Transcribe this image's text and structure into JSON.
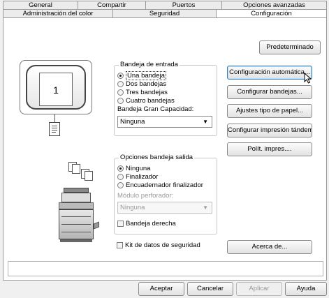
{
  "tabs_top": [
    "General",
    "Compartir",
    "Puertos",
    "Opciones avanzadas"
  ],
  "tabs_bottom": [
    "Administración del color",
    "Seguridad",
    "Configuración"
  ],
  "buttons": {
    "predeterminado": "Predeterminado",
    "config_auto": "Configuración automática...",
    "config_bandejas": "Configurar bandejas...",
    "ajustes_papel": "Ajustes tipo de papel...",
    "config_tandem": "Configurar impresión tándem...",
    "polit_impres": "Polít. impres....",
    "acerca": "Acerca de...",
    "aceptar": "Aceptar",
    "cancelar": "Cancelar",
    "aplicar": "Aplicar",
    "ayuda": "Ayuda"
  },
  "tray_badge": "1",
  "bandeja_entrada": {
    "legend": "Bandeja de entrada",
    "options": [
      "Una bandeja",
      "Dos bandejas",
      "Tres bandejas",
      "Cuatro bandejas"
    ],
    "selected": 0,
    "gran_capacidad_label": "Bandeja Gran Capacidad:",
    "gran_capacidad_value": "Ninguna"
  },
  "bandeja_salida": {
    "legend": "Opciones bandeja salida",
    "options": [
      "Ninguna",
      "Finalizador",
      "Encuadernador finalizador"
    ],
    "selected": 0,
    "modulo_label": "Módulo perforador:",
    "modulo_value": "Ninguna",
    "bandeja_derecha": "Bandeja derecha"
  },
  "kit_seguridad": "Kit de datos de seguridad"
}
